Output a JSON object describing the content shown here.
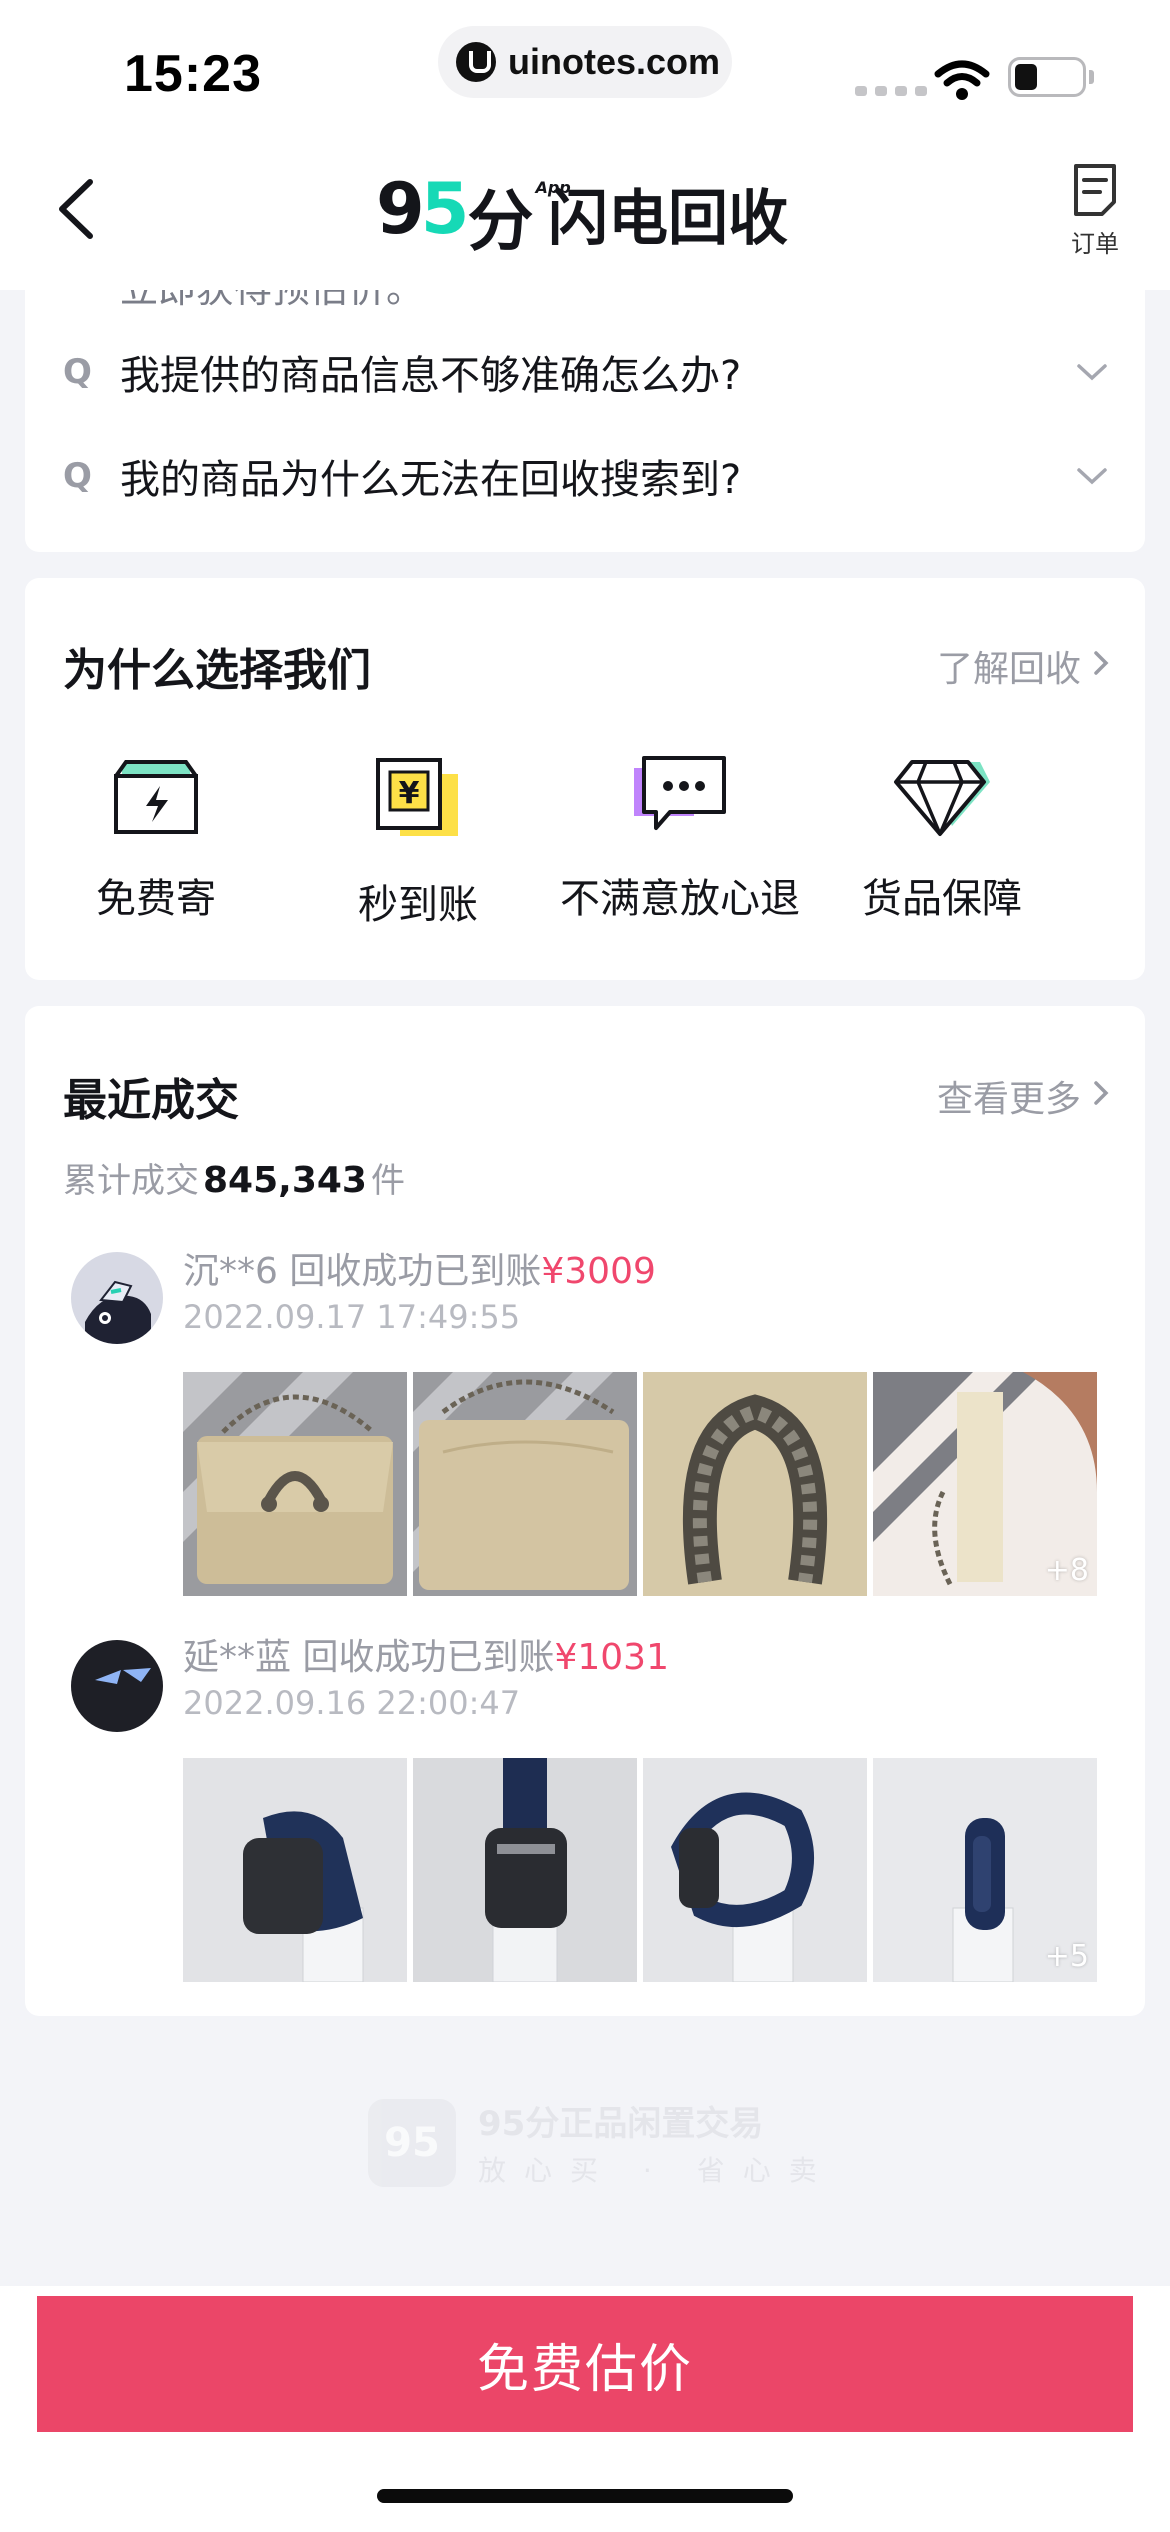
{
  "status_bar": {
    "time": "15:23",
    "url": "uinotes.com"
  },
  "nav": {
    "logo_main": "9",
    "logo_five": "5",
    "logo_fen": "分",
    "logo_app": "App",
    "title": "闪电回收",
    "order_label": "订单"
  },
  "faq": {
    "cutoff_text": "立即获得预估价。",
    "q_marker": "Q",
    "items": [
      {
        "text": "我提供的商品信息不够准确怎么办?"
      },
      {
        "text": "我的商品为什么无法在回收搜索到?"
      }
    ]
  },
  "why": {
    "title": "为什么选择我们",
    "link": "了解回收",
    "features": [
      {
        "label": "免费寄",
        "icon": "free-shipping-box-icon"
      },
      {
        "label": "秒到账",
        "icon": "instant-payment-icon"
      },
      {
        "label": "不满意放心退",
        "icon": "chat-bubble-icon"
      },
      {
        "label": "货品保障",
        "icon": "diamond-icon"
      }
    ]
  },
  "recent": {
    "title": "最近成交",
    "link": "查看更多",
    "total_prefix": "累计成交",
    "total_count": "845,343",
    "total_suffix": "件",
    "deals": [
      {
        "user": "沉**6",
        "status": " 回收成功已到账",
        "price": "¥3009",
        "time": "2022.09.17 17:49:55",
        "more": "+8"
      },
      {
        "user": "延**蓝",
        "status": " 回收成功已到账",
        "price": "¥1031",
        "time": "2022.09.16 22:00:47",
        "more": "+5"
      }
    ]
  },
  "footer_brand": {
    "logo": "95",
    "line1": "95分正品闲置交易",
    "line2": "放心买 · 省心卖"
  },
  "cta": {
    "label": "免费估价"
  },
  "colors": {
    "accent": "#eb4668",
    "price": "#f0476d",
    "brand_green": "#16d9b6"
  }
}
